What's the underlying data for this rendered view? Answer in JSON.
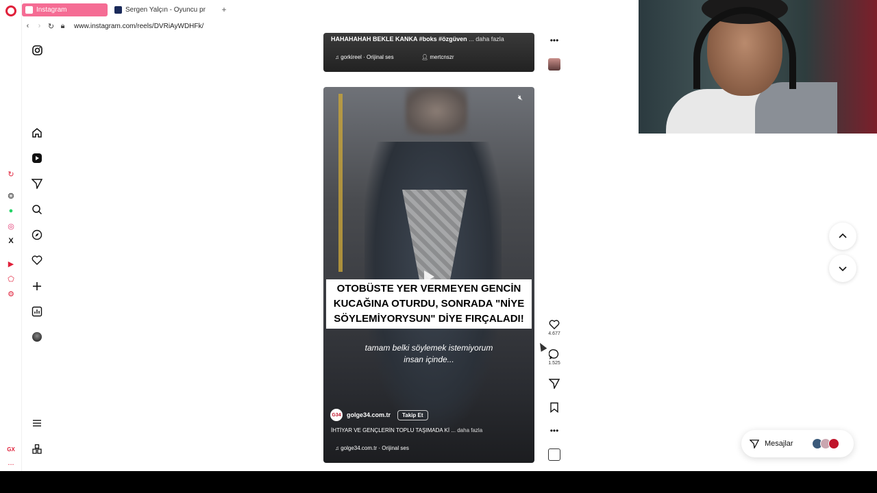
{
  "browser": {
    "tabs": [
      {
        "title": "Instagram",
        "active": true,
        "favicon": "instagram-icon",
        "color": "#f56c94"
      },
      {
        "title": "Sergen Yalçın - Oyuncu pr",
        "active": false,
        "favicon": "site-icon"
      }
    ],
    "new_tab": "+",
    "url": "www.instagram.com/reels/DVRiAyWDHFk/",
    "sidebar_bottom": {
      "gx": "GX",
      "more": "..."
    }
  },
  "ig_nav": [
    "instagram-logo",
    "home-icon",
    "reels-icon",
    "messages-icon",
    "search-icon",
    "explore-icon",
    "notifications-icon",
    "create-icon",
    "dashboard-icon",
    "profile-avatar",
    "menu-icon",
    "also-from-meta-icon"
  ],
  "previous_reel": {
    "caption": "HAHAHAHAH BEKLE KANKA #boks #özgüven",
    "more": "... daha fazla",
    "audio": "gorkireel · Orijinal ses",
    "collab": "mertcnszr"
  },
  "reel": {
    "headline_lines": [
      "OTOBÜSTE YER VERMEYEN GENCİN",
      "KUCAĞINA OTURDU, SONRADA \"NİYE",
      "SÖYLEMİYORYSUN\" DİYE FIRÇALADI!"
    ],
    "subtitle_lines": [
      "tamam belki söylemek istemiyorum",
      "insan içinde..."
    ],
    "owner": "golge34.com.tr",
    "owner_avatar": "G34",
    "follow": "Takip Et",
    "description": "İHTİYAR VE GENÇLERİN TOPLU TAŞIMADA Kİ ...",
    "more": "daha fazla",
    "audio": "golge34.com.tr · Orijinal ses"
  },
  "actions": {
    "likes": "4.677",
    "comments": "1.525"
  },
  "messages": {
    "label": "Mesajlar"
  },
  "colors": {
    "accent": "#f56c94",
    "opera_red": "#e0203a"
  }
}
